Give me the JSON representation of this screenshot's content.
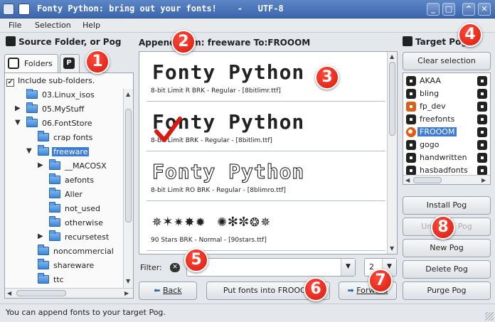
{
  "window": {
    "title": "Fonty Python: bring out your fonts!    -   UTF-8",
    "controls": [
      "minimize",
      "maximize",
      "shade",
      "close"
    ]
  },
  "menu": {
    "file": "File",
    "selection": "Selection",
    "help": "Help"
  },
  "source": {
    "heading": "Source Folder, or Pog",
    "tabs": [
      {
        "label": "Folders"
      },
      {
        "label": ""
      }
    ],
    "include_subfolders": "Include sub-folders.",
    "tree": [
      {
        "label": "03.Linux_isos",
        "expander": ""
      },
      {
        "label": "05.MyStuff",
        "expander": "▶"
      },
      {
        "label": "06.FontStore",
        "expander": "▼"
      },
      {
        "label": "crap fonts",
        "expander": ""
      },
      {
        "label": "freeware",
        "expander": "▼"
      },
      {
        "label": "__MACOSX",
        "expander": "▶"
      },
      {
        "label": "aefonts",
        "expander": ""
      },
      {
        "label": "Aller",
        "expander": ""
      },
      {
        "label": "not_used",
        "expander": ""
      },
      {
        "label": "otherwise",
        "expander": ""
      },
      {
        "label": "recursetest",
        "expander": "▶"
      },
      {
        "label": "noncommercial",
        "expander": ""
      },
      {
        "label": "shareware",
        "expander": ""
      },
      {
        "label": "ttc",
        "expander": ""
      }
    ]
  },
  "center": {
    "heading": "Append from: freeware To:FROOOM",
    "fonts": [
      {
        "sample": "Fonty Python",
        "name": "8-bit Limit R BRK - Regular - [8bitlimr.ttf]",
        "style": "normal",
        "checked": false
      },
      {
        "sample": "Fonty Python",
        "name": "8-bit Limit BRK - Regular - [8bitlim.ttf]",
        "style": "normal",
        "checked": true
      },
      {
        "sample": "Fonty Python",
        "name": "8-bit Limit RO BRK - Regular - [8blimro.ttf]",
        "style": "outline",
        "checked": false
      },
      {
        "sample": "✵✶✷✸✹ ✺✻✼❂✵",
        "name": "90 Stars BRK - Normal - [90stars.ttf]",
        "style": "stars",
        "checked": false
      }
    ],
    "filter_label": "Filter:",
    "filter_value": "",
    "page_value": "2",
    "back_label": "Back",
    "put_label": "Put fonts into FROOOM",
    "forward_label": "Forward"
  },
  "target": {
    "heading": "Target Pogs",
    "clear_label": "Clear selection",
    "pogs": [
      {
        "label": "AKAA",
        "state": "normal"
      },
      {
        "label": "bling",
        "state": "normal"
      },
      {
        "label": "fp_dev",
        "state": "installed"
      },
      {
        "label": "freefonts",
        "state": "normal"
      },
      {
        "label": "FROOOM",
        "state": "target"
      },
      {
        "label": "gogo",
        "state": "normal"
      },
      {
        "label": "handwritten",
        "state": "normal"
      },
      {
        "label": "hasbadfonts",
        "state": "normal"
      }
    ],
    "buttons": {
      "install": "Install Pog",
      "uninstall": "Uninstall Pog",
      "new": "New Pog",
      "delete": "Delete Pog",
      "purge": "Purge Pog"
    }
  },
  "status": "You can append fonts to your target Pog.",
  "callouts": [
    "1",
    "2",
    "3",
    "4",
    "5",
    "6",
    "7",
    "8"
  ],
  "colors": {
    "accent": "#3e7bd6",
    "callout": "#e0201a",
    "titlebar": "#4a72b8"
  }
}
